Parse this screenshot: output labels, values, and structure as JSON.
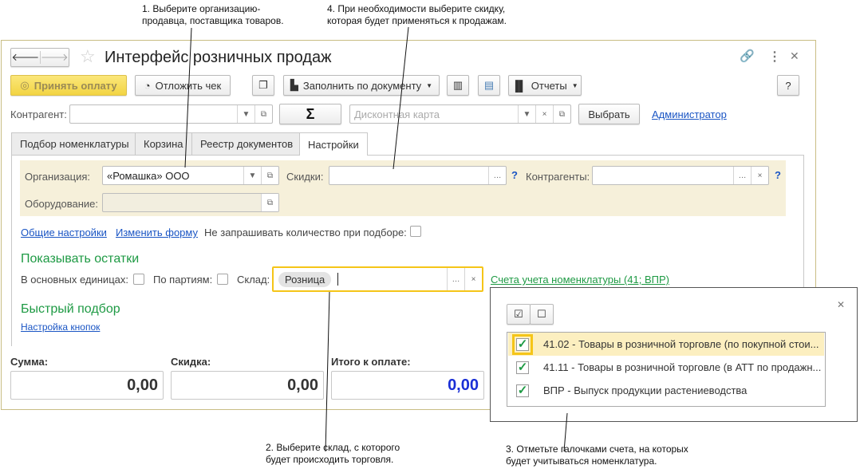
{
  "annotations": {
    "n1": [
      "1. Выберите организацию-",
      "продавца, поставщика товаров."
    ],
    "n4": [
      "4. При необходимости выберите скидку,",
      "которая будет применяться к продажам."
    ],
    "n2": [
      "2. Выберите склад, с которого",
      "будет происходить торговля."
    ],
    "n3": [
      "3. Отметьте галочками счета, на которых",
      "будет учитываться номенклатура."
    ]
  },
  "window": {
    "title": "Интерфейс розничных продаж"
  },
  "toolbar": {
    "accept": "Принять оплату",
    "postpone": "Отложить чек",
    "fill": "Заполнить по документу",
    "reports": "Отчеты",
    "help": "?"
  },
  "row2": {
    "counterparty_label": "Контрагент:",
    "counterparty_value": "",
    "sigma": "Σ",
    "discount_card_placeholder": "Дисконтная карта",
    "choose": "Выбрать",
    "admin": "Администратор"
  },
  "tabs": [
    "Подбор номенклатуры",
    "Корзина",
    "Реестр документов",
    "Настройки"
  ],
  "settings": {
    "org_label": "Организация:",
    "org_value": "«Ромашка» ООО",
    "discounts_label": "Скидки:",
    "discounts_value": "",
    "counterparties_label": "Контрагенты:",
    "counterparties_value": "",
    "equipment_label": "Оборудование:",
    "equipment_value": "",
    "q": "?",
    "general": "Общие настройки",
    "change_form": "Изменить форму",
    "no_qty": "Не запрашивать количество при подборе:",
    "show_stock": "Показывать остатки",
    "base_units": "В основных единицах:",
    "by_batches": "По партиям:",
    "warehouse_label": "Склад:",
    "warehouse_value": "Розница",
    "accounts_link": "Счета учета номенклатуры (41; ВПР)",
    "quick": "Быстрый подбор",
    "buttons_setup": "Настройка кнопок"
  },
  "totals": {
    "sum_label": "Сумма:",
    "sum": "0,00",
    "discount_label": "Скидка:",
    "discount": "0,00",
    "total_label": "Итого к оплате:",
    "total": "0,00"
  },
  "popup": {
    "items": [
      {
        "label": "41.02 - Товары в розничной торговле (по покупной стои...",
        "checked": true
      },
      {
        "label": "41.11 - Товары в розничной торговле (в АТТ по продажн...",
        "checked": true
      },
      {
        "label": "ВПР - Выпуск продукции растениеводства",
        "checked": true
      }
    ]
  },
  "colors": {
    "accent": "#f5d94a",
    "green": "#1e9a44",
    "link": "#1a55c4",
    "panel": "#f6f0da",
    "total_blue": "#1a2fd6"
  }
}
